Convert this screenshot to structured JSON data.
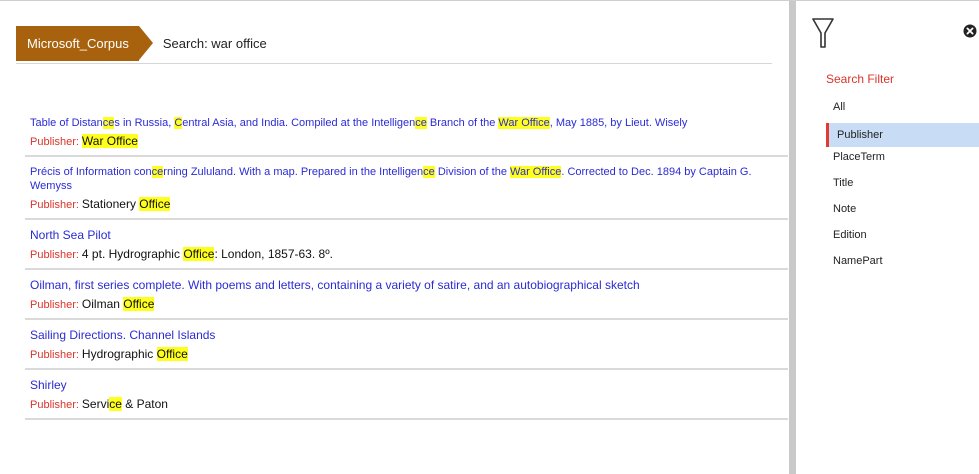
{
  "breadcrumb": {
    "corpus": "Microsoft_Corpus",
    "search": "Search: war office"
  },
  "results": [
    {
      "title": [
        {
          "t": "Table of Distan"
        },
        {
          "t": "ce",
          "h": true
        },
        {
          "t": "s in Russia, "
        },
        {
          "t": "C",
          "h": true
        },
        {
          "t": "entral Asia, and India. Compiled at the Intelligen"
        },
        {
          "t": "ce",
          "h": true
        },
        {
          "t": " Branch of the "
        },
        {
          "t": "War Office",
          "h": true
        },
        {
          "t": ", May 1885, by Lieut. Wisely"
        }
      ],
      "publisher_label": "Publisher:",
      "publisher": [
        {
          "t": "War Office",
          "h": true
        }
      ]
    },
    {
      "title": [
        {
          "t": "Précis of Information con"
        },
        {
          "t": "ce",
          "h": true
        },
        {
          "t": "rning Zululand. With a map. Prepared in the Intelligen"
        },
        {
          "t": "ce",
          "h": true
        },
        {
          "t": " Division of the "
        },
        {
          "t": "War Office",
          "h": true
        },
        {
          "t": ". Corrected to Dec. 1894 by Captain G. Wemyss"
        }
      ],
      "publisher_label": "Publisher:",
      "publisher": [
        {
          "t": "Stationery "
        },
        {
          "t": "Office",
          "h": true
        }
      ]
    },
    {
      "title": [
        {
          "t": "North Sea Pilot"
        }
      ],
      "publisher_label": "Publisher:",
      "publisher": [
        {
          "t": "4 pt. Hydrographic "
        },
        {
          "t": "Office",
          "h": true
        },
        {
          "t": ": London, 1857-63. 8º."
        }
      ]
    },
    {
      "title": [
        {
          "t": "Oilman, first series complete. With poems and letters, containing a variety of satire, and an autobiographical sketch"
        }
      ],
      "publisher_label": "Publisher:",
      "publisher": [
        {
          "t": "Oilman "
        },
        {
          "t": "Office",
          "h": true
        }
      ]
    },
    {
      "title": [
        {
          "t": "Sailing Directions. Channel Islands"
        }
      ],
      "publisher_label": "Publisher:",
      "publisher": [
        {
          "t": "Hydrographic "
        },
        {
          "t": "Office",
          "h": true
        }
      ]
    },
    {
      "title": [
        {
          "t": "Shirley"
        }
      ],
      "publisher_label": "Publisher:",
      "publisher": [
        {
          "t": "Servi"
        },
        {
          "t": "ce",
          "h": true
        },
        {
          "t": " & Paton"
        }
      ]
    }
  ],
  "filter_panel": {
    "title": "Search Filter",
    "items": [
      "All",
      "Publisher",
      "PlaceTerm",
      "Title",
      "Note",
      "Edition",
      "NamePart"
    ],
    "active": "Publisher",
    "icons": {
      "filter": "funnel-icon",
      "close": "close-icon"
    }
  },
  "colors": {
    "accent": "#a8620d",
    "link": "#2b2bd4",
    "label": "#d9342b",
    "highlight": "#ffff1e",
    "active_bg": "#c8dcf6"
  }
}
